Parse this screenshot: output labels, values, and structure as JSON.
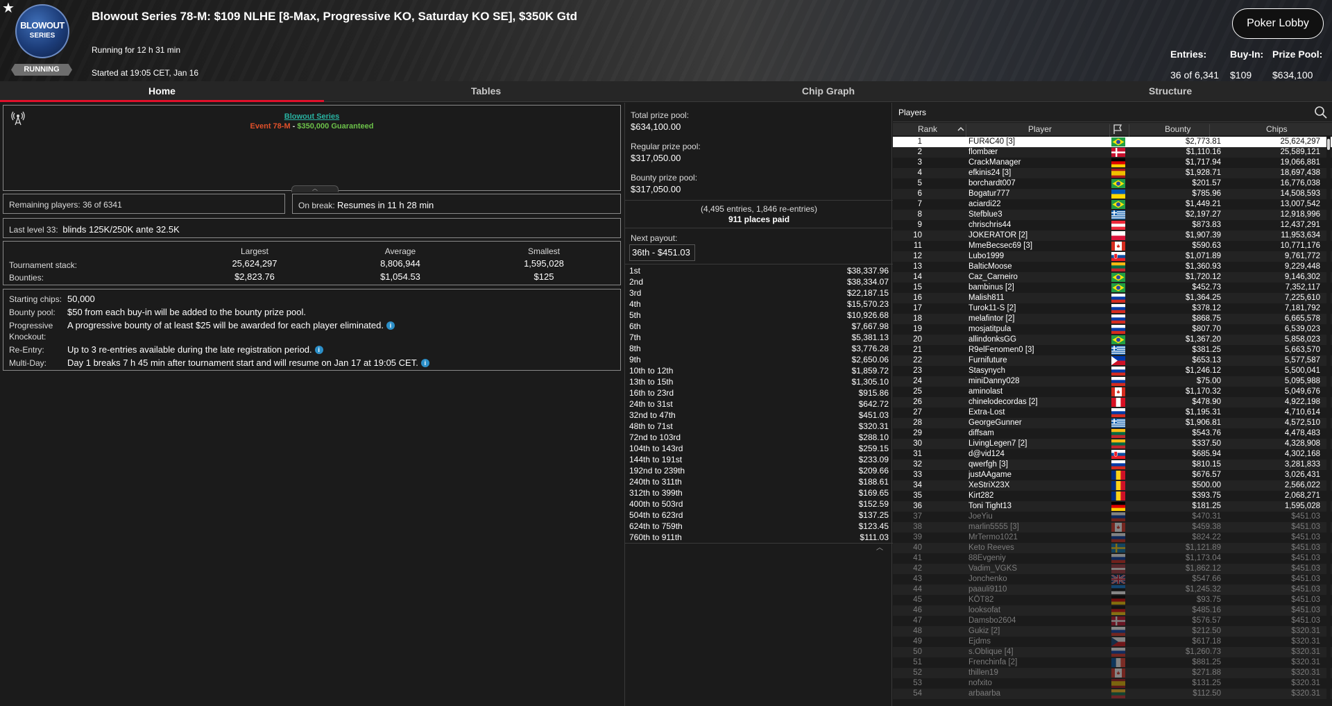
{
  "header": {
    "logo_line1": "BLOWOUT",
    "logo_line2": "SERIES",
    "status": "RUNNING",
    "title": "Blowout Series 78-M: $109 NLHE [8-Max, Progressive KO, Saturday KO SE], $350K Gtd",
    "running_for": "Running for 12 h 31 min",
    "started_at": "Started at 19:05 CET, Jan 16",
    "lobby_button": "Poker Lobby",
    "entries_label": "Entries:",
    "entries_value": "36 of 6,341",
    "buyin_label": "Buy-In:",
    "buyin_value": "$109",
    "prizepool_label": "Prize Pool:",
    "prizepool_value": "$634,100"
  },
  "tabs": [
    {
      "label": "Home",
      "active": true
    },
    {
      "label": "Tables",
      "active": false
    },
    {
      "label": "Chip Graph",
      "active": false
    },
    {
      "label": "Structure",
      "active": false
    }
  ],
  "home": {
    "banner_series": "Blowout Series",
    "banner_event": "Event 78-M",
    "banner_sep": " - ",
    "banner_gtd": "$350,000 Guaranteed",
    "remaining_label": "Remaining players:",
    "remaining_value": "36 of 6341",
    "break_label": "On break:",
    "break_value": "Resumes in 11 h 28 min",
    "level_label": "Last level 33:",
    "level_value": "blinds 125K/250K ante 32.5K",
    "stack": {
      "col_largest": "Largest",
      "col_average": "Average",
      "col_smallest": "Smallest",
      "row1_label": "Tournament stack:",
      "row2_label": "Bounties:",
      "largest_stack": "25,624,297",
      "average_stack": "8,806,944",
      "smallest_stack": "1,595,028",
      "largest_bounty": "$2,823.76",
      "average_bounty": "$1,054.53",
      "smallest_bounty": "$125"
    },
    "info": {
      "starting_label": "Starting chips:",
      "starting_value": "50,000",
      "bountypool_label": "Bounty pool:",
      "bountypool_value": "$50 from each buy-in will be added to the bounty prize pool.",
      "pko_label1": "Progressive",
      "pko_label2": "Knockout:",
      "pko_value": "A progressive bounty of at least $25 will be awarded for each player eliminated.",
      "reentry_label": "Re-Entry:",
      "reentry_value": "Up to 3 re-entries available during the late registration period.",
      "multiday_label": "Multi-Day:",
      "multiday_value": "Day 1 breaks 7 h 45 min after tournament start and will resume on Jan 17 at 19:05 CET."
    }
  },
  "prizes": {
    "total_label": "Total prize pool:",
    "total_value": "$634,100.00",
    "regular_label": "Regular prize pool:",
    "regular_value": "$317,050.00",
    "bounty_label": "Bounty prize pool:",
    "bounty_value": "$317,050.00",
    "entries_note": "(4,495 entries, 1,846 re-entries)",
    "places_paid": "911 places paid",
    "next_payout_label": "Next payout:",
    "next_payout_value": "36th - $451.03",
    "payouts": [
      [
        "1st",
        "$38,337.96"
      ],
      [
        "2nd",
        "$38,334.07"
      ],
      [
        "3rd",
        "$22,187.15"
      ],
      [
        "4th",
        "$15,570.23"
      ],
      [
        "5th",
        "$10,926.68"
      ],
      [
        "6th",
        "$7,667.98"
      ],
      [
        "7th",
        "$5,381.13"
      ],
      [
        "8th",
        "$3,776.28"
      ],
      [
        "9th",
        "$2,650.06"
      ],
      [
        "10th to 12th",
        "$1,859.72"
      ],
      [
        "13th to 15th",
        "$1,305.10"
      ],
      [
        "16th to 23rd",
        "$915.86"
      ],
      [
        "24th to 31st",
        "$642.72"
      ],
      [
        "32nd to 47th",
        "$451.03"
      ],
      [
        "48th to 71st",
        "$320.31"
      ],
      [
        "72nd to 103rd",
        "$288.10"
      ],
      [
        "104th to 143rd",
        "$259.15"
      ],
      [
        "144th to 191st",
        "$233.09"
      ],
      [
        "192nd to 239th",
        "$209.66"
      ],
      [
        "240th to 311th",
        "$188.61"
      ],
      [
        "312th to 399th",
        "$169.65"
      ],
      [
        "400th to 503rd",
        "$152.59"
      ],
      [
        "504th to 623rd",
        "$137.25"
      ],
      [
        "624th to 759th",
        "$123.45"
      ],
      [
        "760th to 911th",
        "$111.03"
      ]
    ]
  },
  "players": {
    "title": "Players",
    "col_rank": "Rank",
    "col_player": "Player",
    "col_bounty": "Bounty",
    "col_chips": "Chips",
    "rows": [
      [
        1,
        "FUR4C40 [3]",
        "br",
        "$2,773.81",
        "25,624,297"
      ],
      [
        2,
        "flombær",
        "dk",
        "$1,110.16",
        "25,589,121"
      ],
      [
        3,
        "CrackManager",
        "de",
        "$1,717.94",
        "19,066,881"
      ],
      [
        4,
        "efkinis24 [3]",
        "es",
        "$1,928.71",
        "18,697,438"
      ],
      [
        5,
        "borchardt007",
        "br",
        "$201.57",
        "16,776,038"
      ],
      [
        6,
        "Bogatur777",
        "ua",
        "$785.96",
        "14,508,593"
      ],
      [
        7,
        "aciardi22",
        "br",
        "$1,449.21",
        "13,007,542"
      ],
      [
        8,
        "Stefblue3",
        "gr",
        "$2,197.27",
        "12,918,996"
      ],
      [
        9,
        "chrischris44",
        "at",
        "$873.83",
        "12,437,291"
      ],
      [
        10,
        "JOKERATOR [2]",
        "pl",
        "$1,907.39",
        "11,953,634"
      ],
      [
        11,
        "MmeBecsec69 [3]",
        "ca",
        "$590.63",
        "10,771,176"
      ],
      [
        12,
        "Lubo1999",
        "sk",
        "$1,071.89",
        "9,761,772"
      ],
      [
        13,
        "BalticMoose",
        "lt",
        "$1,360.93",
        "9,229,448"
      ],
      [
        14,
        "Caz_Carneiro",
        "br",
        "$1,720.12",
        "9,146,302"
      ],
      [
        15,
        "bambinus [2]",
        "br",
        "$452.73",
        "7,352,117"
      ],
      [
        16,
        "Malish811",
        "ru",
        "$1,364.25",
        "7,225,610"
      ],
      [
        17,
        "Turok11-S [2]",
        "ru",
        "$378.12",
        "7,181,792"
      ],
      [
        18,
        "melafintor [2]",
        "ru",
        "$868.75",
        "6,665,578"
      ],
      [
        19,
        "mosjatitpula",
        "ru",
        "$807.70",
        "6,539,023"
      ],
      [
        20,
        "allindonksGG",
        "br",
        "$1,367.20",
        "5,858,023"
      ],
      [
        21,
        "R9elFenomen0 [3]",
        "gr",
        "$381.25",
        "5,663,570"
      ],
      [
        22,
        "Furnifuture",
        "ph",
        "$653.13",
        "5,577,587"
      ],
      [
        23,
        "Stasynych",
        "ru",
        "$1,246.12",
        "5,500,041"
      ],
      [
        24,
        "miniDanny028",
        "ru",
        "$75.00",
        "5,095,988"
      ],
      [
        25,
        "aminolast",
        "ca",
        "$1,170.32",
        "5,049,676"
      ],
      [
        26,
        "chinelodecordas [2]",
        "pe",
        "$478.90",
        "4,922,198"
      ],
      [
        27,
        "Extra-Lost",
        "ru",
        "$1,195.31",
        "4,710,614"
      ],
      [
        28,
        "GeorgeGunner",
        "gr",
        "$1,906.81",
        "4,572,510"
      ],
      [
        29,
        "diffsam",
        "lt",
        "$543.76",
        "4,478,483"
      ],
      [
        30,
        "LivingLegen7 [2]",
        "lt",
        "$337.50",
        "4,328,908"
      ],
      [
        31,
        "d@vid124",
        "sk",
        "$685.94",
        "4,302,168"
      ],
      [
        32,
        "qwerfgh [3]",
        "ru",
        "$810.15",
        "3,281,833"
      ],
      [
        33,
        "justAAgame",
        "ro",
        "$676.57",
        "3,026,431"
      ],
      [
        34,
        "XeStriX23X",
        "ro",
        "$500.00",
        "2,566,022"
      ],
      [
        35,
        "Kirt282",
        "ro",
        "$393.75",
        "2,068,271"
      ],
      [
        36,
        "Toni Tight13",
        "de",
        "$181.25",
        "1,595,028"
      ],
      [
        37,
        "JoeYiu",
        "ru",
        "$470.31",
        "$451.03"
      ],
      [
        38,
        "marlin5555 [3]",
        "ca",
        "$459.38",
        "$451.03"
      ],
      [
        39,
        "MrTermo1021",
        "ru",
        "$824.22",
        "$451.03"
      ],
      [
        40,
        "Keto Reeves",
        "se",
        "$1,121.89",
        "$451.03"
      ],
      [
        41,
        "88Evgeniy",
        "ru",
        "$1,173.04",
        "$451.03"
      ],
      [
        42,
        "Vadim_VGKS",
        "lv",
        "$1,862.12",
        "$451.03"
      ],
      [
        43,
        "Jonchenko",
        "gb",
        "$547.66",
        "$451.03"
      ],
      [
        44,
        "paauli9110",
        "ee",
        "$1,245.32",
        "$451.03"
      ],
      [
        45,
        "KÖT82",
        "de",
        "$93.75",
        "$451.03"
      ],
      [
        46,
        "looksofat",
        "de",
        "$485.16",
        "$451.03"
      ],
      [
        47,
        "Damsbo2604",
        "dk",
        "$576.57",
        "$451.03"
      ],
      [
        48,
        "Gukiz [2]",
        "ru",
        "$212.50",
        "$320.31"
      ],
      [
        49,
        "Ejdms",
        "cz",
        "$617.18",
        "$320.31"
      ],
      [
        50,
        "s.Oblique [4]",
        "ru",
        "$1,260.73",
        "$320.31"
      ],
      [
        51,
        "Frenchinfa [2]",
        "fr",
        "$881.25",
        "$320.31"
      ],
      [
        52,
        "thillen19",
        "ca",
        "$271.88",
        "$320.31"
      ],
      [
        53,
        "nofxito",
        "es",
        "$131.25",
        "$320.31"
      ],
      [
        54,
        "arbaarba",
        "lt",
        "$112.50",
        "$320.31"
      ]
    ]
  },
  "colors": {
    "accent_red": "#e0102a",
    "banner_teal": "#29b3a2",
    "event_orange": "#e0502a",
    "gtd_green": "#6cc24a",
    "info_blue": "#2c8fc8"
  },
  "icons": [
    "star-icon",
    "antenna-icon",
    "info-icon",
    "search-icon",
    "sort-arrow-icon",
    "flag-icon",
    "chevron-up-icon"
  ]
}
